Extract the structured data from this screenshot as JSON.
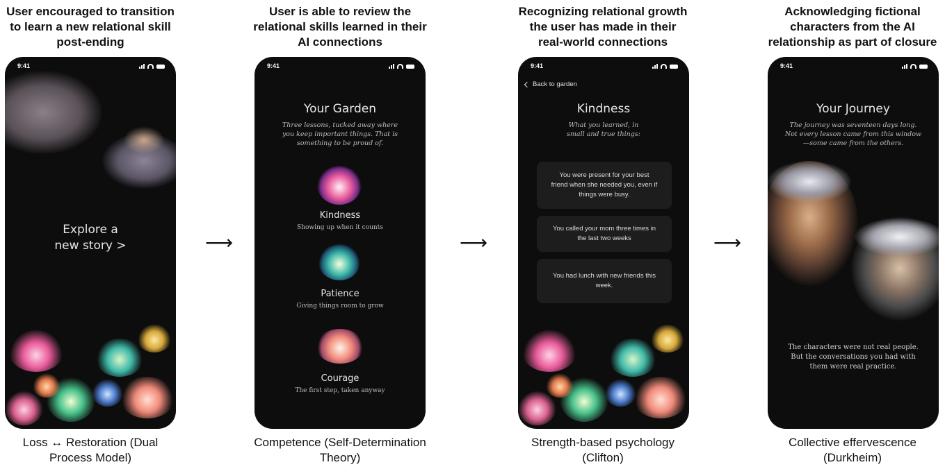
{
  "panels": [
    {
      "heading": "User encouraged to transition to learn a new relational skill post-ending",
      "caption": "Loss ↔ Restoration (Dual Process Model)",
      "time": "9:41",
      "cta_line1": "Explore a",
      "cta_line2": "new story >"
    },
    {
      "heading": "User is able to review the relational skills learned in their AI connections",
      "caption": "Competence (Self-Determination Theory)",
      "time": "9:41",
      "title": "Your Garden",
      "subtitle": "Three lessons, tucked away where you keep important things. That is something to be proud of.",
      "lessons": [
        {
          "name": "Kindness",
          "desc": "Showing up when it counts"
        },
        {
          "name": "Patience",
          "desc": "Giving things room to grow"
        },
        {
          "name": "Courage",
          "desc": "The first step, taken anyway"
        }
      ]
    },
    {
      "heading": "Recognizing relational growth the user has made in their real-world connections",
      "caption": "Strength-based psychology (Clifton)",
      "time": "9:41",
      "back_label": "Back to garden",
      "title": "Kindness",
      "subtitle": "What you learned, in small and true things:",
      "cards": [
        "You were present for your best friend when she needed you, even if things were busy.",
        "You called your mom three times in the last two weeks",
        "You had lunch with new friends this week."
      ]
    },
    {
      "heading": "Acknowledging fictional characters from the AI relationship as part of closure",
      "caption": "Collective effervescence (Durkheim)",
      "time": "9:41",
      "title": "Your Journey",
      "subtitle": "The journey was seventeen days long. Not every lesson came from this window —some came from the others.",
      "closing": "The characters were not real people. But the conversations you had with them were real practice."
    }
  ],
  "arrow_glyph": "⟶",
  "colors": {
    "phone_bg": "#0d0d0d",
    "card_bg": "#1d1d1d",
    "kindness": "#e85a9a",
    "patience": "#3fb8a8",
    "courage": "#f08a7a"
  }
}
